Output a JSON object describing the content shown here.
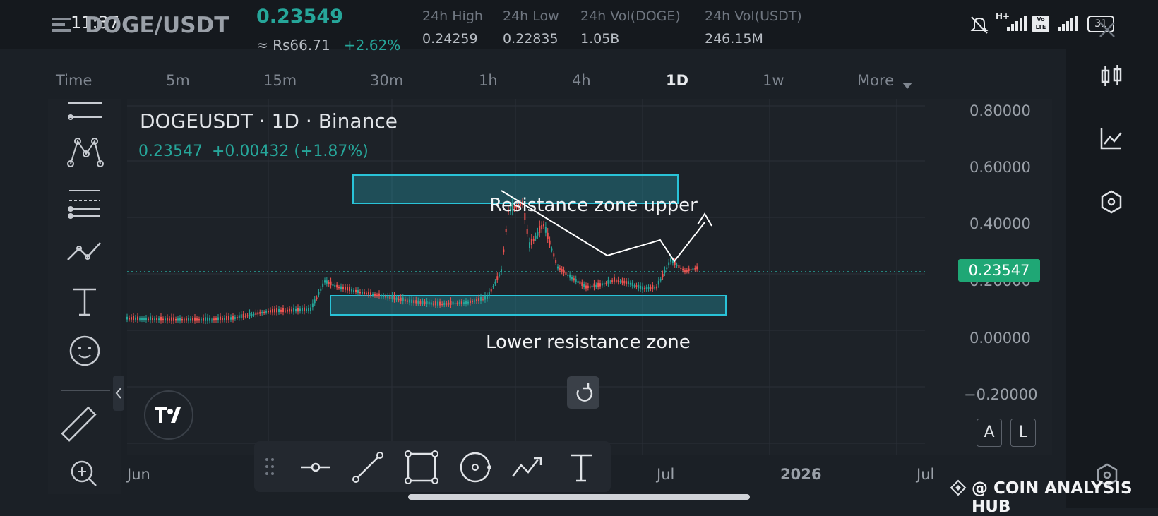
{
  "status_bar": {
    "time": "11:37",
    "battery": "31",
    "network": "H+",
    "lte": "Vo LTE"
  },
  "header": {
    "pair": "DOGE/USDT",
    "price": "0.23549",
    "price_local": "≈ Rs66.71",
    "change_pct": "+2.62%",
    "stats": [
      {
        "label": "24h High",
        "value": "0.24259"
      },
      {
        "label": "24h Low",
        "value": "0.22835"
      },
      {
        "label": "24h Vol(DOGE)",
        "value": "1.05B"
      },
      {
        "label": "24h Vol(USDT)",
        "value": "246.15M"
      }
    ]
  },
  "timeframes": [
    "Time",
    "5m",
    "15m",
    "30m",
    "1h",
    "4h",
    "1D",
    "1w",
    "More"
  ],
  "active_timeframe": "1D",
  "chart": {
    "symbol_title": "DOGEUSDT · 1D · Binance",
    "price": "0.23547",
    "change": "+0.00432 (+1.87%)",
    "current_price_label": "0.23547",
    "y_labels": [
      "0.80000",
      "0.60000",
      "0.40000",
      "0.20000",
      "0.00000",
      "−0.20000"
    ],
    "x_labels": [
      "Jun",
      "Jul",
      "2026",
      "Jul"
    ],
    "annotations": {
      "upper": "Resistance zone upper",
      "lower": "Lower resistance zone"
    },
    "badges": [
      "A",
      "L"
    ]
  },
  "colors": {
    "up": "#26a69a",
    "down": "#ef5350",
    "zone": "#29c3d8",
    "price_badge": "#1fa775"
  },
  "watermark": "@ COIN ANALYSIS HUB"
}
